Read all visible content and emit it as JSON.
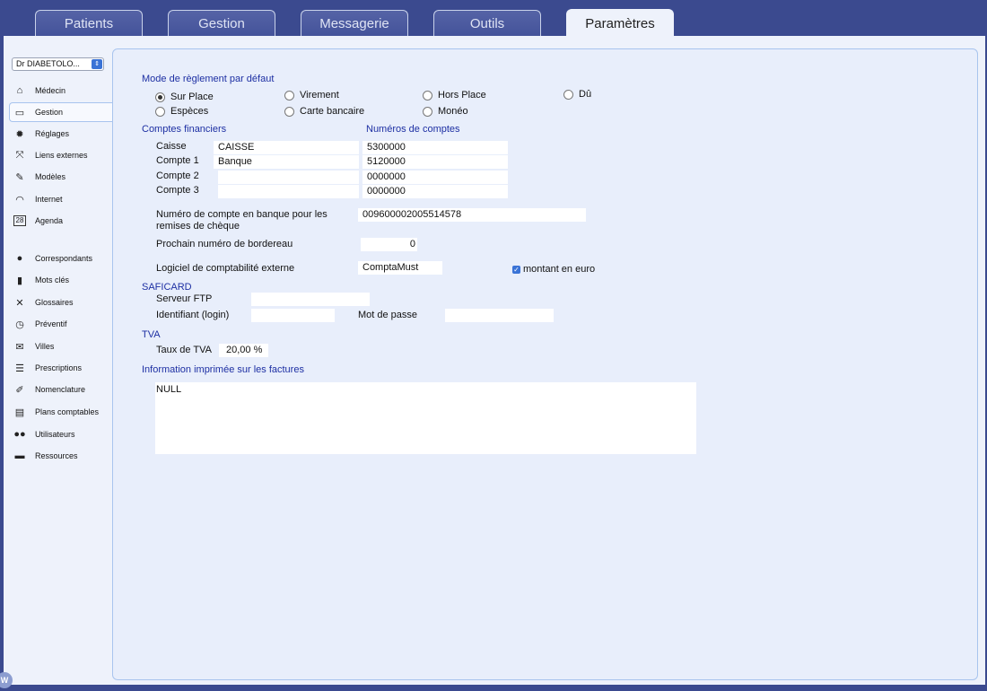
{
  "tabs": [
    "Patients",
    "Gestion",
    "Messagerie",
    "Outils",
    "Paramètres"
  ],
  "active_tab": "Paramètres",
  "sidebar": {
    "doctor_select": "Dr DIABETOLO...",
    "items": [
      {
        "label": "Médecin",
        "icon": "home-icon"
      },
      {
        "label": "Gestion",
        "icon": "tray-icon",
        "active": true
      },
      {
        "label": "Réglages",
        "icon": "gear-icon"
      },
      {
        "label": "Liens externes",
        "icon": "expand-arrows-icon"
      },
      {
        "label": "Modèles",
        "icon": "edit-icon"
      },
      {
        "label": "Internet",
        "icon": "wifi-icon"
      },
      {
        "label": "Agenda",
        "icon": "calendar-icon"
      },
      {
        "label": "Correspondants",
        "icon": "person-icon"
      },
      {
        "label": "Mots clés",
        "icon": "bar-chart-icon"
      },
      {
        "label": "Glossaires",
        "icon": "tools-icon"
      },
      {
        "label": "Préventif",
        "icon": "clock-icon"
      },
      {
        "label": "Villes",
        "icon": "envelope-icon"
      },
      {
        "label": "Prescriptions",
        "icon": "list-icon"
      },
      {
        "label": "Nomenclature",
        "icon": "pencil-icon"
      },
      {
        "label": "Plans comptables",
        "icon": "table-icon"
      },
      {
        "label": "Utilisateurs",
        "icon": "users-icon"
      },
      {
        "label": "Ressources",
        "icon": "car-icon"
      }
    ],
    "calendar_day": "28"
  },
  "reglement": {
    "title": "Mode de règlement par défaut",
    "options": [
      "Sur Place",
      "Virement",
      "Hors Place",
      "Dû",
      "Espèces",
      "Carte bancaire",
      "Monéo"
    ],
    "selected": "Sur Place"
  },
  "comptes": {
    "title": "Comptes financiers",
    "numeros_title": "Numéros de comptes",
    "rows": [
      {
        "label": "Caisse",
        "name": "CAISSE",
        "number": "5300000"
      },
      {
        "label": "Compte 1",
        "name": "Banque",
        "number": "5120000"
      },
      {
        "label": "Compte 2",
        "name": "",
        "number": "0000000"
      },
      {
        "label": "Compte 3",
        "name": "",
        "number": "0000000"
      }
    ]
  },
  "banque": {
    "label": "Numéro de compte en banque pour les remises de chèque",
    "value": "009600002005514578"
  },
  "bordereau": {
    "label": "Prochain numéro de bordereau",
    "value": "0"
  },
  "logiciel": {
    "label": "Logiciel de comptabilité externe",
    "value": "ComptaMust",
    "euro_label": "montant en euro",
    "euro_checked": true
  },
  "saficard": {
    "title": "SAFICARD",
    "ftp_label": "Serveur FTP",
    "ftp_value": "",
    "login_label": "Identifiant (login)",
    "login_value": "",
    "password_label": "Mot de passe",
    "password_value": ""
  },
  "tva": {
    "title": "TVA",
    "label": "Taux de TVA",
    "value": "20,00 %"
  },
  "factures": {
    "title": "Information imprimée sur les factures",
    "value": "NULL"
  },
  "corner_logo": "W"
}
